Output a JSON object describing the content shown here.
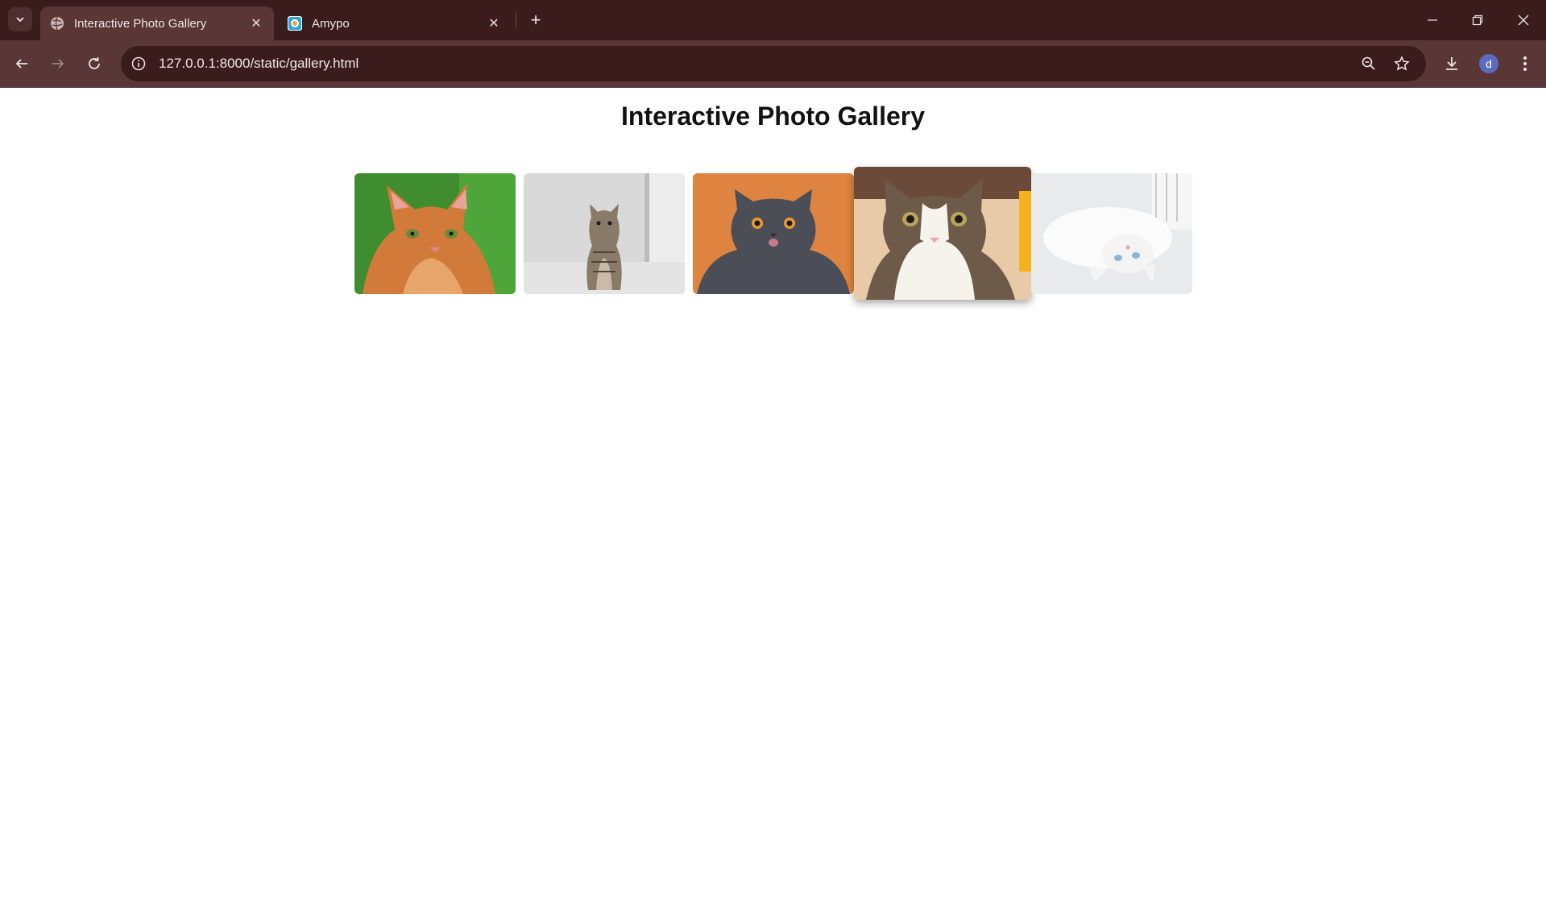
{
  "browser": {
    "tabs": [
      {
        "title": "Interactive Photo Gallery",
        "active": true,
        "favicon": "globe-icon"
      },
      {
        "title": "Amypo",
        "active": false,
        "favicon": "amypo-logo-icon"
      }
    ],
    "url": "127.0.0.1:8000/static/gallery.html",
    "profile_initial": "d",
    "colors": {
      "frame": "#3a1c1c",
      "toolbar": "#5a3636",
      "avatar": "#5c6bc0"
    }
  },
  "page": {
    "title": "Interactive Photo Gallery",
    "photos": [
      {
        "subject": "orange tabby cat on green background"
      },
      {
        "subject": "tabby kitten sitting by window"
      },
      {
        "subject": "grey british shorthair cat on orange background"
      },
      {
        "subject": "white and tabby cat looking up",
        "state": "hovered"
      },
      {
        "subject": "white fluffy kitten lying on back"
      }
    ]
  }
}
